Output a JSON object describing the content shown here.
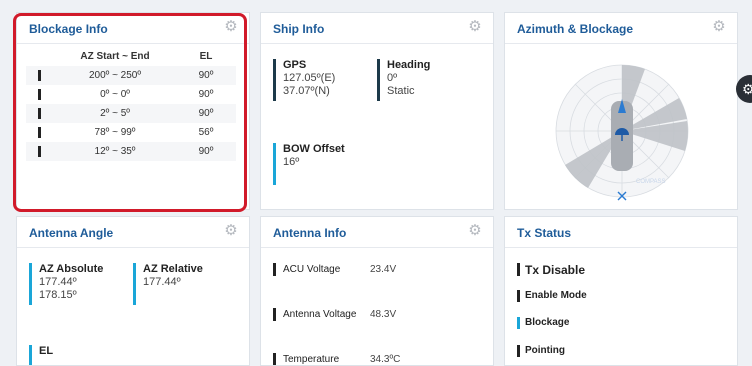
{
  "blockage": {
    "title": "Blockage Info",
    "col_range": "AZ Start ~ End",
    "col_el": "EL",
    "rows": [
      {
        "range": "200º ~ 250º",
        "el": "90º"
      },
      {
        "range": "0º ~ 0º",
        "el": "90º"
      },
      {
        "range": "2º ~ 5º",
        "el": "90º"
      },
      {
        "range": "78º ~ 99º",
        "el": "56º"
      },
      {
        "range": "12º ~ 35º",
        "el": "90º"
      }
    ]
  },
  "ship": {
    "title": "Ship Info",
    "gps_label": "GPS",
    "gps_lon": "127.05º(E)",
    "gps_lat": "37.07º(N)",
    "heading_label": "Heading",
    "heading_value": "0º",
    "heading_mode": "Static",
    "bow_label": "BOW Offset",
    "bow_value": "16º"
  },
  "azimuth": {
    "title": "Azimuth & Blockage",
    "compass_text": "COMPASS"
  },
  "antenna_angle": {
    "title": "Antenna Angle",
    "az_abs_label": "AZ Absolute",
    "az_abs_value1": "177.44º",
    "az_abs_value2": "178.15º",
    "az_rel_label": "AZ Relative",
    "az_rel_value": "177.44º",
    "el_label": "EL"
  },
  "antenna_info": {
    "title": "Antenna Info",
    "rows": [
      {
        "label": "ACU Voltage",
        "value": "23.4V"
      },
      {
        "label": "Antenna Voltage",
        "value": "48.3V"
      },
      {
        "label": "Temperature",
        "value": "34.3ºC"
      }
    ]
  },
  "tx": {
    "title": "Tx Status",
    "state": "Tx Disable",
    "items": [
      {
        "label": "Enable Mode",
        "color": "#222222"
      },
      {
        "label": "Blockage",
        "color": "#1aa6d8"
      },
      {
        "label": "Pointing",
        "color": "#222222"
      }
    ]
  },
  "colors": {
    "title": "#1f5c99",
    "highlight": "#d11a2a",
    "accent": "#1aa6d8"
  }
}
